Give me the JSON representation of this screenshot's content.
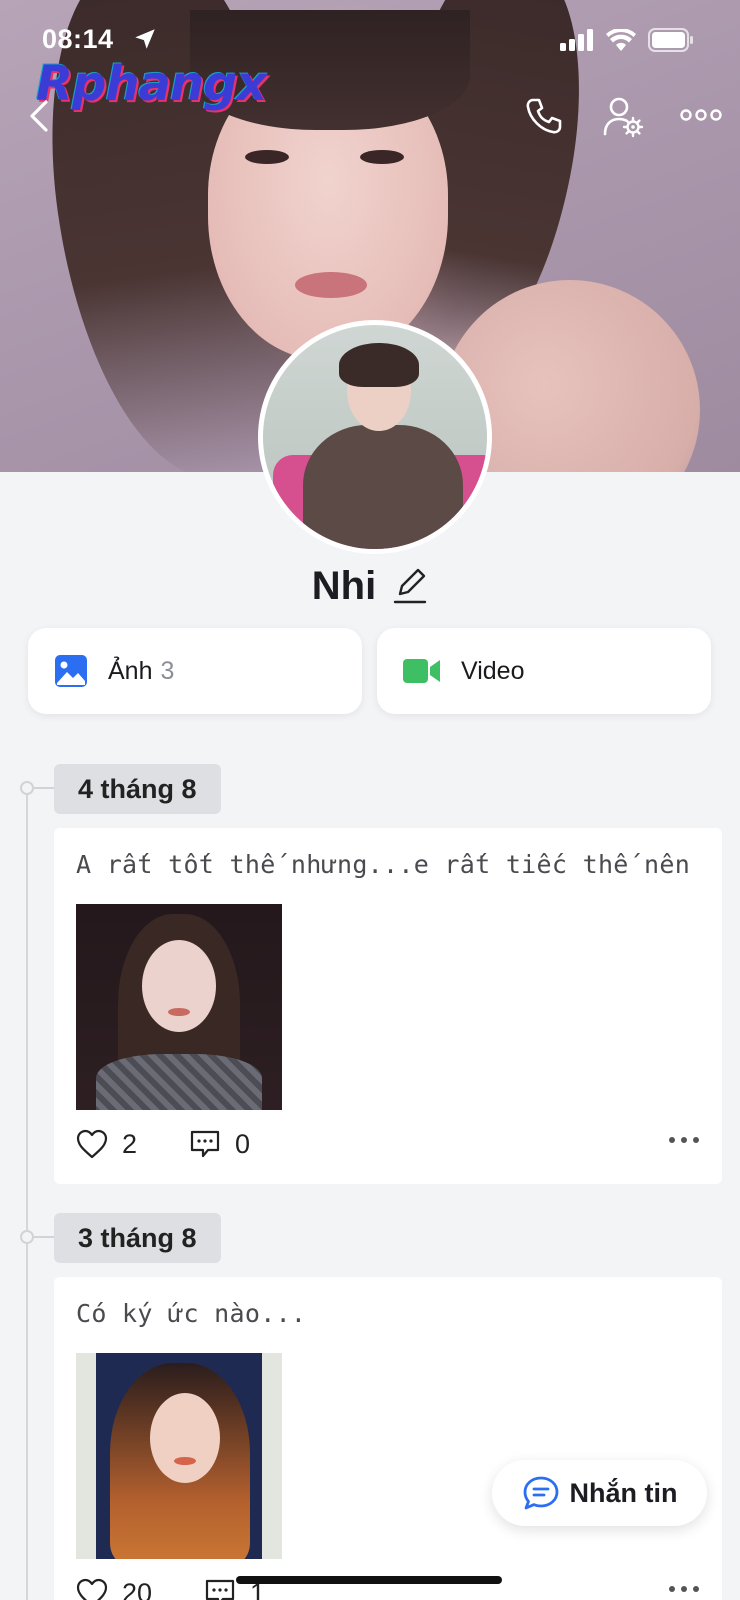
{
  "status_bar": {
    "time": "08:14",
    "icons": [
      "location-arrow-icon",
      "cellular-signal-icon",
      "wifi-icon",
      "battery-icon"
    ]
  },
  "watermark": "Rphangx",
  "header": {
    "icons": [
      "chevron-left-icon",
      "phone-icon",
      "user-settings-icon",
      "more-horizontal-icon"
    ]
  },
  "profile": {
    "name": "Nhi",
    "edit_icon": "pencil-icon"
  },
  "media": {
    "photos_label": "Ảnh",
    "photos_count": "3",
    "videos_label": "Video",
    "photos_icon_color": "#2c6ef2",
    "videos_icon_color": "#3fbf63"
  },
  "timeline": [
    {
      "date": "4 tháng 8",
      "text": "A rất tốt thế nhưng...e rất tiếc thế nên",
      "likes": "2",
      "comments": "0"
    },
    {
      "date": "3 tháng 8",
      "text": "Có ký ức nào...",
      "likes": "20",
      "comments": "1"
    }
  ],
  "message_button": {
    "label": "Nhắn tin",
    "icon_color": "#2c6ef2"
  }
}
